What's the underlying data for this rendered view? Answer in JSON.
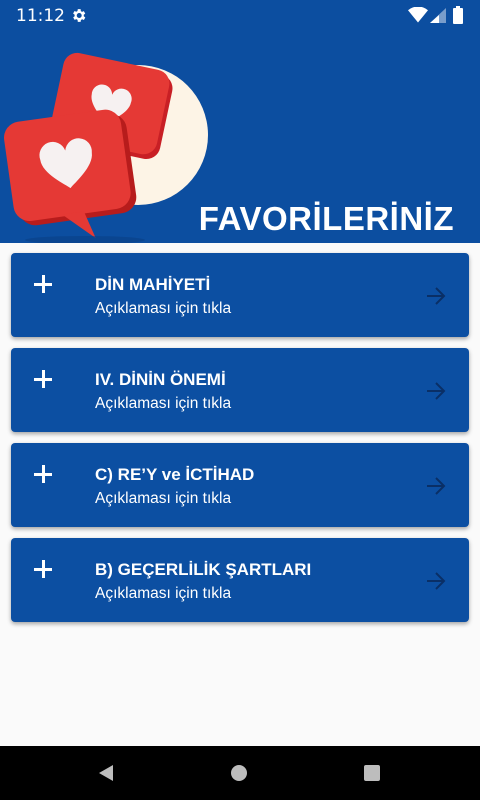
{
  "status_bar": {
    "time": "11:12",
    "icons": [
      "gear-icon",
      "wifi-icon",
      "signal-icon",
      "battery-icon"
    ]
  },
  "header": {
    "title": "FAVORİLERİNİZ",
    "illustration": "heart-speech-bubbles"
  },
  "items": [
    {
      "title": "DİN MAHİYETİ",
      "subtitle": "Açıklaması için tıkla"
    },
    {
      "title": "IV. DİNİN ÖNEMİ",
      "subtitle": "Açıklaması için tıkla"
    },
    {
      "title": "C) RE’Y ve İCTİHAD",
      "subtitle": "Açıklaması için tıkla"
    },
    {
      "title": "B) GEÇERLİLİK ŞARTLARI",
      "subtitle": "Açıklaması için tıkla"
    }
  ],
  "nav_bar": {
    "buttons": [
      "back-icon",
      "home-icon",
      "recents-icon"
    ]
  },
  "colors": {
    "primary": "#0c4ea0",
    "card": "#0c4fa2",
    "background": "#fafafa",
    "heart_bubble": "#e53935"
  }
}
